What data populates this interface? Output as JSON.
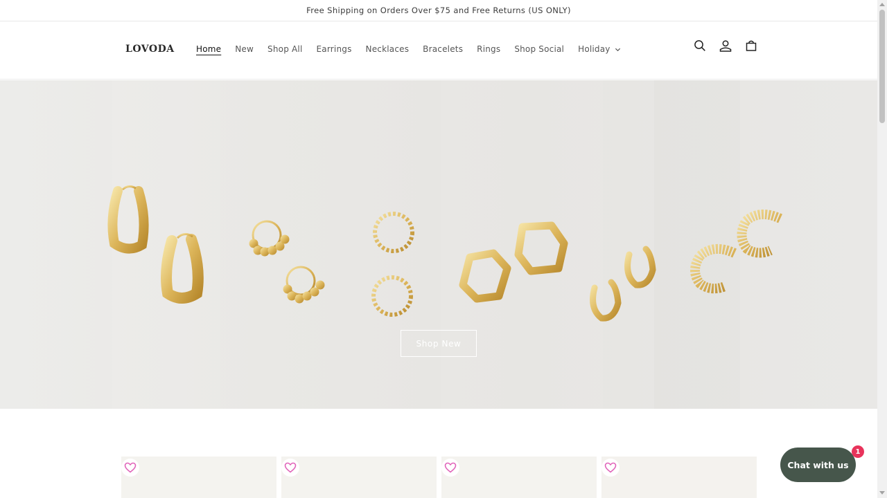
{
  "announcement": {
    "text": "Free Shipping on Orders Over $75 and Free Returns (US ONLY)"
  },
  "header": {
    "logo": "LOVODA",
    "nav": [
      {
        "label": "Home",
        "active": true
      },
      {
        "label": "New"
      },
      {
        "label": "Shop All"
      },
      {
        "label": "Earrings"
      },
      {
        "label": "Necklaces"
      },
      {
        "label": "Bracelets"
      },
      {
        "label": "Rings"
      },
      {
        "label": "Shop Social"
      },
      {
        "label": "Holiday",
        "dropdown": true
      }
    ],
    "icons": [
      "search-icon",
      "account-icon",
      "cart-icon"
    ]
  },
  "hero": {
    "button_label": "Shop New"
  },
  "products": {
    "wishlist_icon": "heart-icon",
    "count_visible": 4
  },
  "chat": {
    "label": "Chat with us",
    "badge": "1"
  },
  "colors": {
    "chat_bg": "#46564b",
    "badge": "#e8335b",
    "heart": "#e060b8",
    "gold": "#d9b24a"
  }
}
